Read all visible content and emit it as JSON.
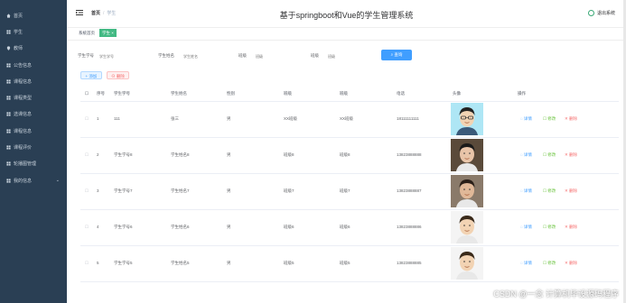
{
  "sidebar": {
    "items": [
      {
        "label": "首页",
        "icon": "home-icon"
      },
      {
        "label": "学生",
        "icon": "grid-icon"
      },
      {
        "label": "教师",
        "icon": "location-icon"
      },
      {
        "label": "公告信息",
        "icon": "grid-icon"
      },
      {
        "label": "课程信息",
        "icon": "grid-icon"
      },
      {
        "label": "课程类型",
        "icon": "grid-icon"
      },
      {
        "label": "选课信息",
        "icon": "grid-icon"
      },
      {
        "label": "课程信息",
        "icon": "grid-icon"
      },
      {
        "label": "课程评价",
        "icon": "grid-icon"
      },
      {
        "label": "轮播图管理",
        "icon": "grid-icon"
      },
      {
        "label": "我的信息",
        "icon": "grid-icon",
        "chevron": "⌄"
      }
    ]
  },
  "header": {
    "breadcrumb_home": "首页",
    "breadcrumb_sep": "/",
    "breadcrumb_current": "学生",
    "title": "基于springboot和Vue的学生管理系统",
    "logout": "退出系统"
  },
  "tags": {
    "home": "系统首页",
    "current": "学生 ×"
  },
  "search": {
    "fields": [
      {
        "label": "学生学号",
        "placeholder": "学生学号"
      },
      {
        "label": "学生姓名",
        "placeholder": "学生姓名"
      },
      {
        "label": "班级",
        "placeholder": "班级"
      },
      {
        "label": "班级",
        "placeholder": "班级"
      }
    ],
    "button": "查询"
  },
  "actions": {
    "add": "添加",
    "delete": "删除"
  },
  "table": {
    "columns": [
      "序号",
      "学生学号",
      "学生姓名",
      "性别",
      "班级",
      "班级",
      "电话",
      "头像",
      "操作"
    ],
    "rows": [
      {
        "index": "1",
        "student_no": "111",
        "name": "张三",
        "gender": "男",
        "class": "XX班级",
        "grade": "XX班级",
        "phone": "18111111111"
      },
      {
        "index": "2",
        "student_no": "学生学号8",
        "name": "学生姓名8",
        "gender": "男",
        "class": "班级8",
        "grade": "班级8",
        "phone": "13823888888"
      },
      {
        "index": "3",
        "student_no": "学生学号7",
        "name": "学生姓名7",
        "gender": "男",
        "class": "班级7",
        "grade": "班级7",
        "phone": "13823888887"
      },
      {
        "index": "4",
        "student_no": "学生学号6",
        "name": "学生姓名6",
        "gender": "男",
        "class": "班级6",
        "grade": "班级6",
        "phone": "13823888886"
      },
      {
        "index": "5",
        "student_no": "学生学号5",
        "name": "学生姓名5",
        "gender": "男",
        "class": "班级5",
        "grade": "班级5",
        "phone": "13823888885"
      }
    ],
    "op_detail": "◌ 详情",
    "op_edit": "☐ 修改",
    "op_delete": "✕ 删除"
  },
  "watermark": "CSDN @一念 计算机毕设源码程序",
  "colors": {
    "sidebar": "#2a3f54",
    "primary": "#409eff",
    "success": "#42b983",
    "danger": "#f56c6c"
  }
}
